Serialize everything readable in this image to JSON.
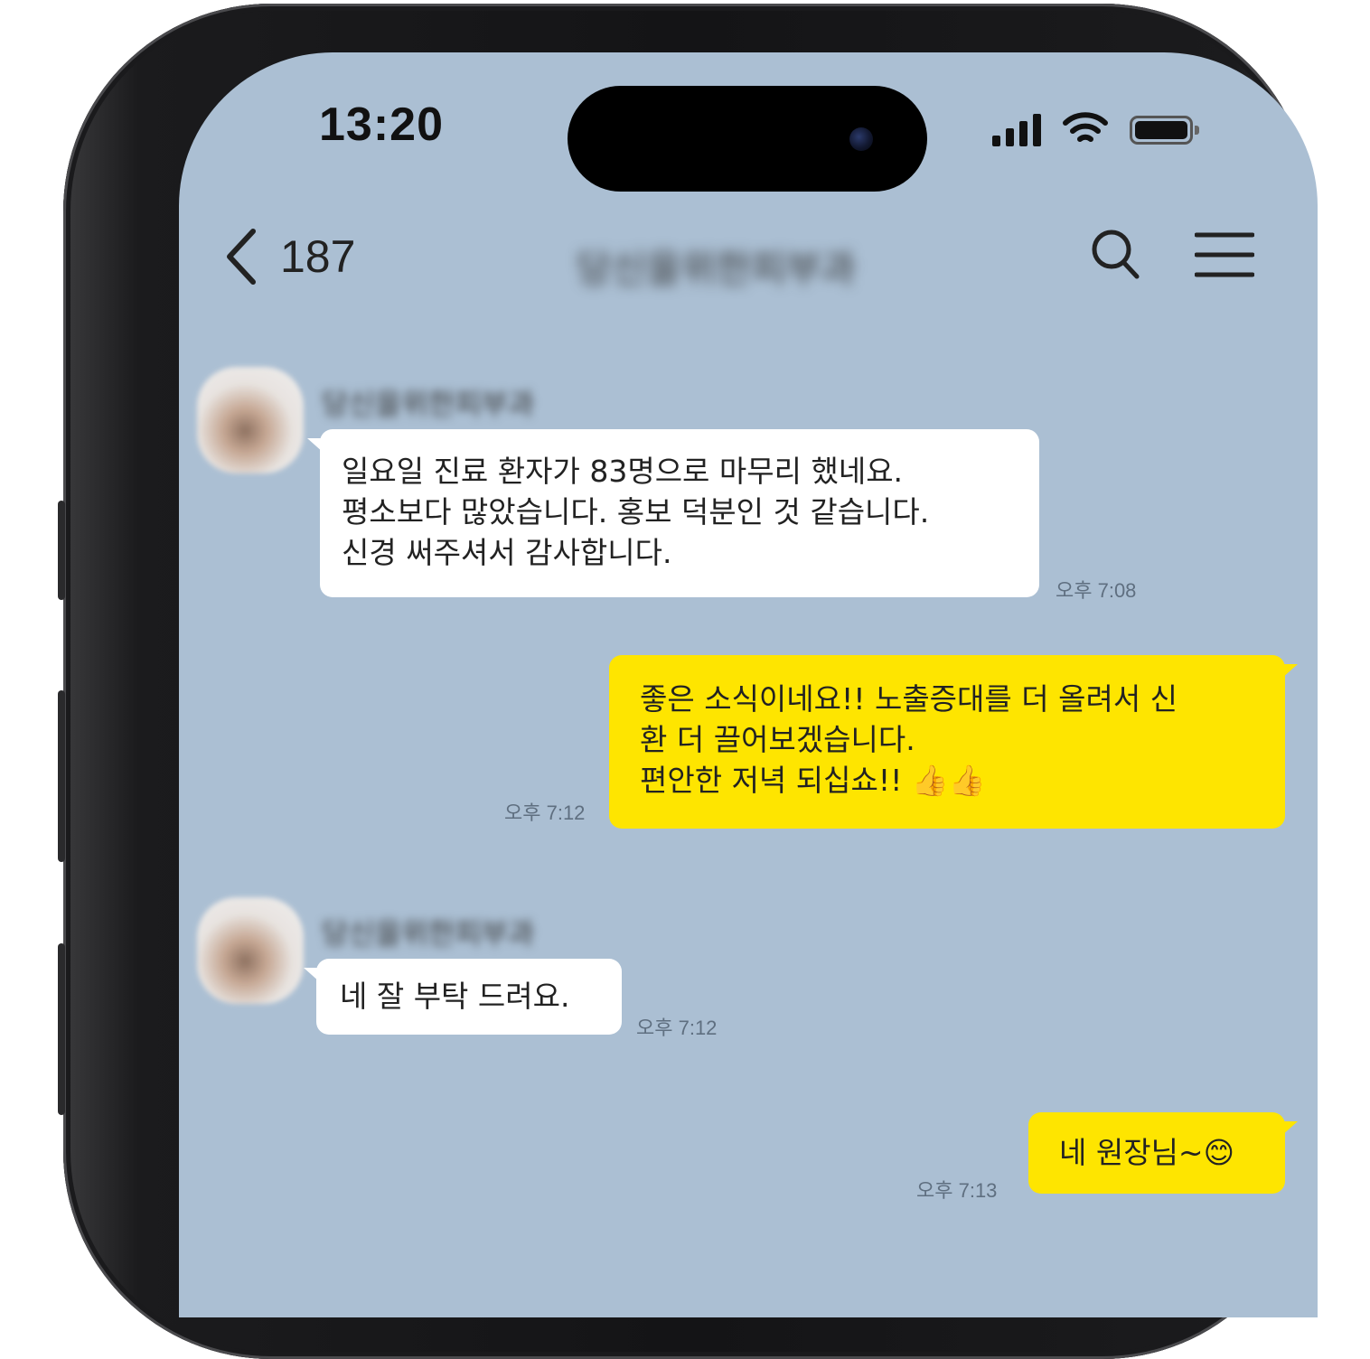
{
  "status_bar": {
    "time": "13:20",
    "icons": [
      "cellular-signal-icon",
      "wifi-icon",
      "battery-icon"
    ]
  },
  "header": {
    "back_icon": "chevron-left-icon",
    "unread_count": "187",
    "chat_title": "당신을위한피부과",
    "search_icon": "search-icon",
    "menu_icon": "hamburger-menu-icon"
  },
  "messages": [
    {
      "direction": "incoming",
      "sender": "당신을위한피부과",
      "text": "일요일 진료 환자가 83명으로 마무리 했네요.\n평소보다 많았습니다. 홍보 덕분인 것 같습니다.\n신경 써주셔서 감사합니다.",
      "time": "오후 7:08"
    },
    {
      "direction": "outgoing",
      "text": "좋은 소식이네요!! 노출증대를 더 올려서 신\n환 더 끌어보겠습니다.\n편안한 저녁 되십쇼!! 👍👍",
      "time": "오후 7:12"
    },
    {
      "direction": "incoming",
      "sender": "당신을위한피부과",
      "text": "네 잘 부탁 드려요.",
      "time": "오후 7:12"
    },
    {
      "direction": "outgoing",
      "text": "네 원장님~😊",
      "time": "오후 7:13"
    }
  ],
  "colors": {
    "chat_background": "#abbfd3",
    "outgoing_bubble": "#fee500",
    "incoming_bubble": "#ffffff"
  }
}
